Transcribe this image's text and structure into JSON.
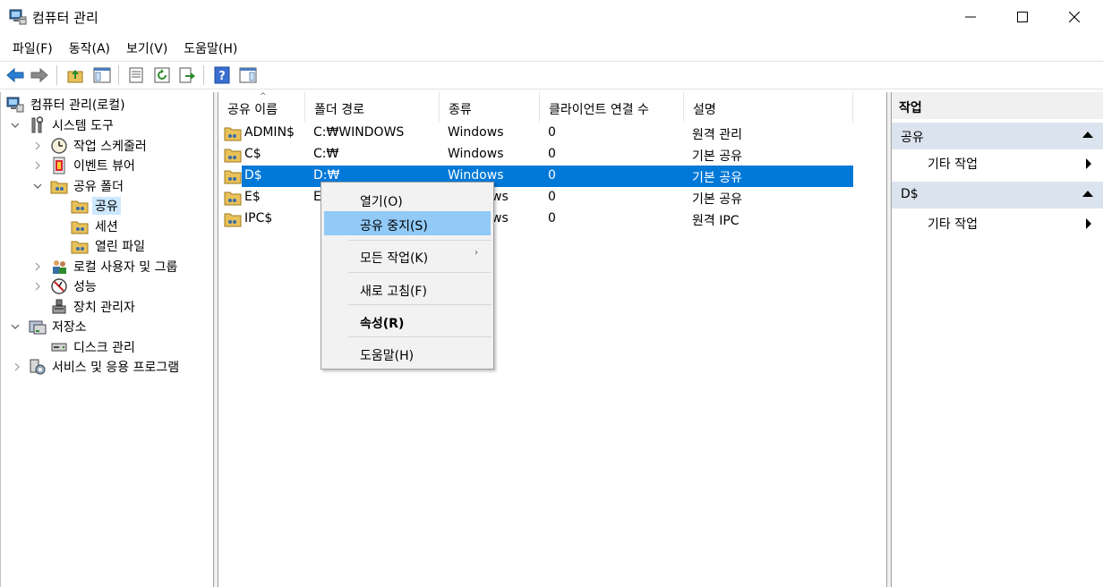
{
  "window": {
    "title": "컴퓨터 관리"
  },
  "menu": [
    "파일(F)",
    "동작(A)",
    "보기(V)",
    "도움말(H)"
  ],
  "tree": {
    "root": "컴퓨터 관리(로컬)",
    "system_tools": "시스템 도구",
    "task_scheduler": "작업 스케줄러",
    "event_viewer": "이벤트 뷰어",
    "shared_folders": "공유 폴더",
    "shares": "공유",
    "sessions": "세션",
    "open_files": "열린 파일",
    "local_users": "로컬 사용자 및 그룹",
    "performance": "성능",
    "device_manager": "장치 관리자",
    "storage": "저장소",
    "disk_management": "디스크 관리",
    "services_apps": "서비스 및 응용 프로그램"
  },
  "list": {
    "columns": [
      "공유 이름",
      "폴더 경로",
      "종류",
      "클라이언트 연결 수",
      "설명"
    ],
    "rows": [
      {
        "name": "ADMIN$",
        "path": "C:₩WINDOWS",
        "type": "Windows",
        "clients": "0",
        "desc": "원격 관리"
      },
      {
        "name": "C$",
        "path": "C:₩",
        "type": "Windows",
        "clients": "0",
        "desc": "기본 공유"
      },
      {
        "name": "D$",
        "path": "D:₩",
        "type": "Windows",
        "clients": "0",
        "desc": "기본 공유"
      },
      {
        "name": "E$",
        "path": "E",
        "type": "ws",
        "clients": "0",
        "desc": "기본 공유"
      },
      {
        "name": "IPC$",
        "path": "",
        "type": "ws",
        "clients": "0",
        "desc": "원격 IPC"
      }
    ]
  },
  "context_menu": {
    "open": "열기(O)",
    "stop_sharing": "공유 중지(S)",
    "all_tasks": "모든 작업(K)",
    "refresh": "새로 고침(F)",
    "properties": "속성(R)",
    "help": "도움말(H)",
    "submenu_glyph": "›"
  },
  "actions": {
    "header": "작업",
    "group1": "공유",
    "group1_item": "기타 작업",
    "group2": "D$",
    "group2_item": "기타 작업"
  },
  "colors": {
    "selection": "#0078d7",
    "menu_hover": "#91c9f7",
    "tree_selected": "#cce8ff",
    "action_group": "#dbe4ee"
  }
}
